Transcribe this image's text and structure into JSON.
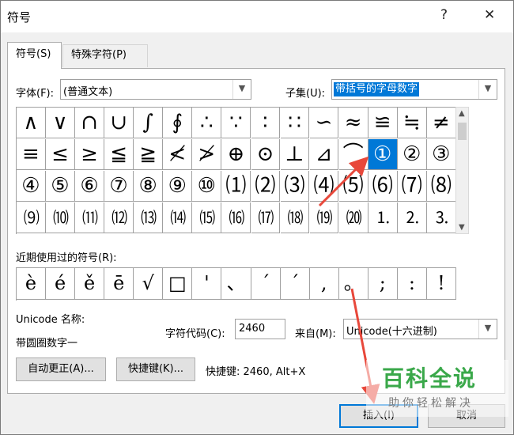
{
  "window": {
    "title": "符号",
    "help_label": "?",
    "close_label": "✕"
  },
  "tabs": [
    {
      "label": "符号(S)"
    },
    {
      "label": "特殊字符(P)"
    }
  ],
  "font": {
    "label": "字体(F):",
    "value": "(普通文本)"
  },
  "subset": {
    "label": "子集(U):",
    "value": "带括号的字母数字"
  },
  "symbol_grid": [
    [
      "∧",
      "∨",
      "∩",
      "∪",
      "∫",
      "∮",
      "∴",
      "∵",
      "∶",
      "∷",
      "∽",
      "≈",
      "≌",
      "≒",
      "≠"
    ],
    [
      "≡",
      "≤",
      "≥",
      "≦",
      "≧",
      "≮",
      "≯",
      "⊕",
      "⊙",
      "⊥",
      "⊿",
      "⌒",
      "①",
      "②",
      "③"
    ],
    [
      "④",
      "⑤",
      "⑥",
      "⑦",
      "⑧",
      "⑨",
      "⑩",
      "⑴",
      "⑵",
      "⑶",
      "⑷",
      "⑸",
      "⑹",
      "⑺",
      "⑻"
    ],
    [
      "⑼",
      "⑽",
      "⑾",
      "⑿",
      "⒀",
      "⒁",
      "⒂",
      "⒃",
      "⒄",
      "⒅",
      "⒆",
      "⒇",
      "⒈",
      "⒉",
      "⒊"
    ]
  ],
  "selected_symbol": "①",
  "recent": {
    "label": "近期使用过的符号(R):",
    "symbols": [
      "è",
      "é",
      "ě",
      "ē",
      "√",
      "□",
      "'",
      "、",
      "ˊ",
      "ˊ",
      ",",
      "。",
      ";",
      ":",
      "!"
    ]
  },
  "unicode_name": {
    "label": "Unicode 名称:",
    "value": "带圆圈数字一"
  },
  "char_code": {
    "label": "字符代码(C):",
    "value": "2460"
  },
  "from": {
    "label": "来自(M):",
    "value": "Unicode(十六进制)"
  },
  "buttons": {
    "autocorrect": "自动更正(A)...",
    "shortcut_key": "快捷键(K)...",
    "shortcut_info": "快捷键: 2460, Alt+X",
    "insert": "插入(I)",
    "cancel": "取消"
  },
  "watermark": {
    "main": "百科全说",
    "sub": "助你轻松解决"
  },
  "colors": {
    "selection": "#0078d7",
    "arrow": "#e8483b",
    "watermark": "#3aa84a"
  }
}
